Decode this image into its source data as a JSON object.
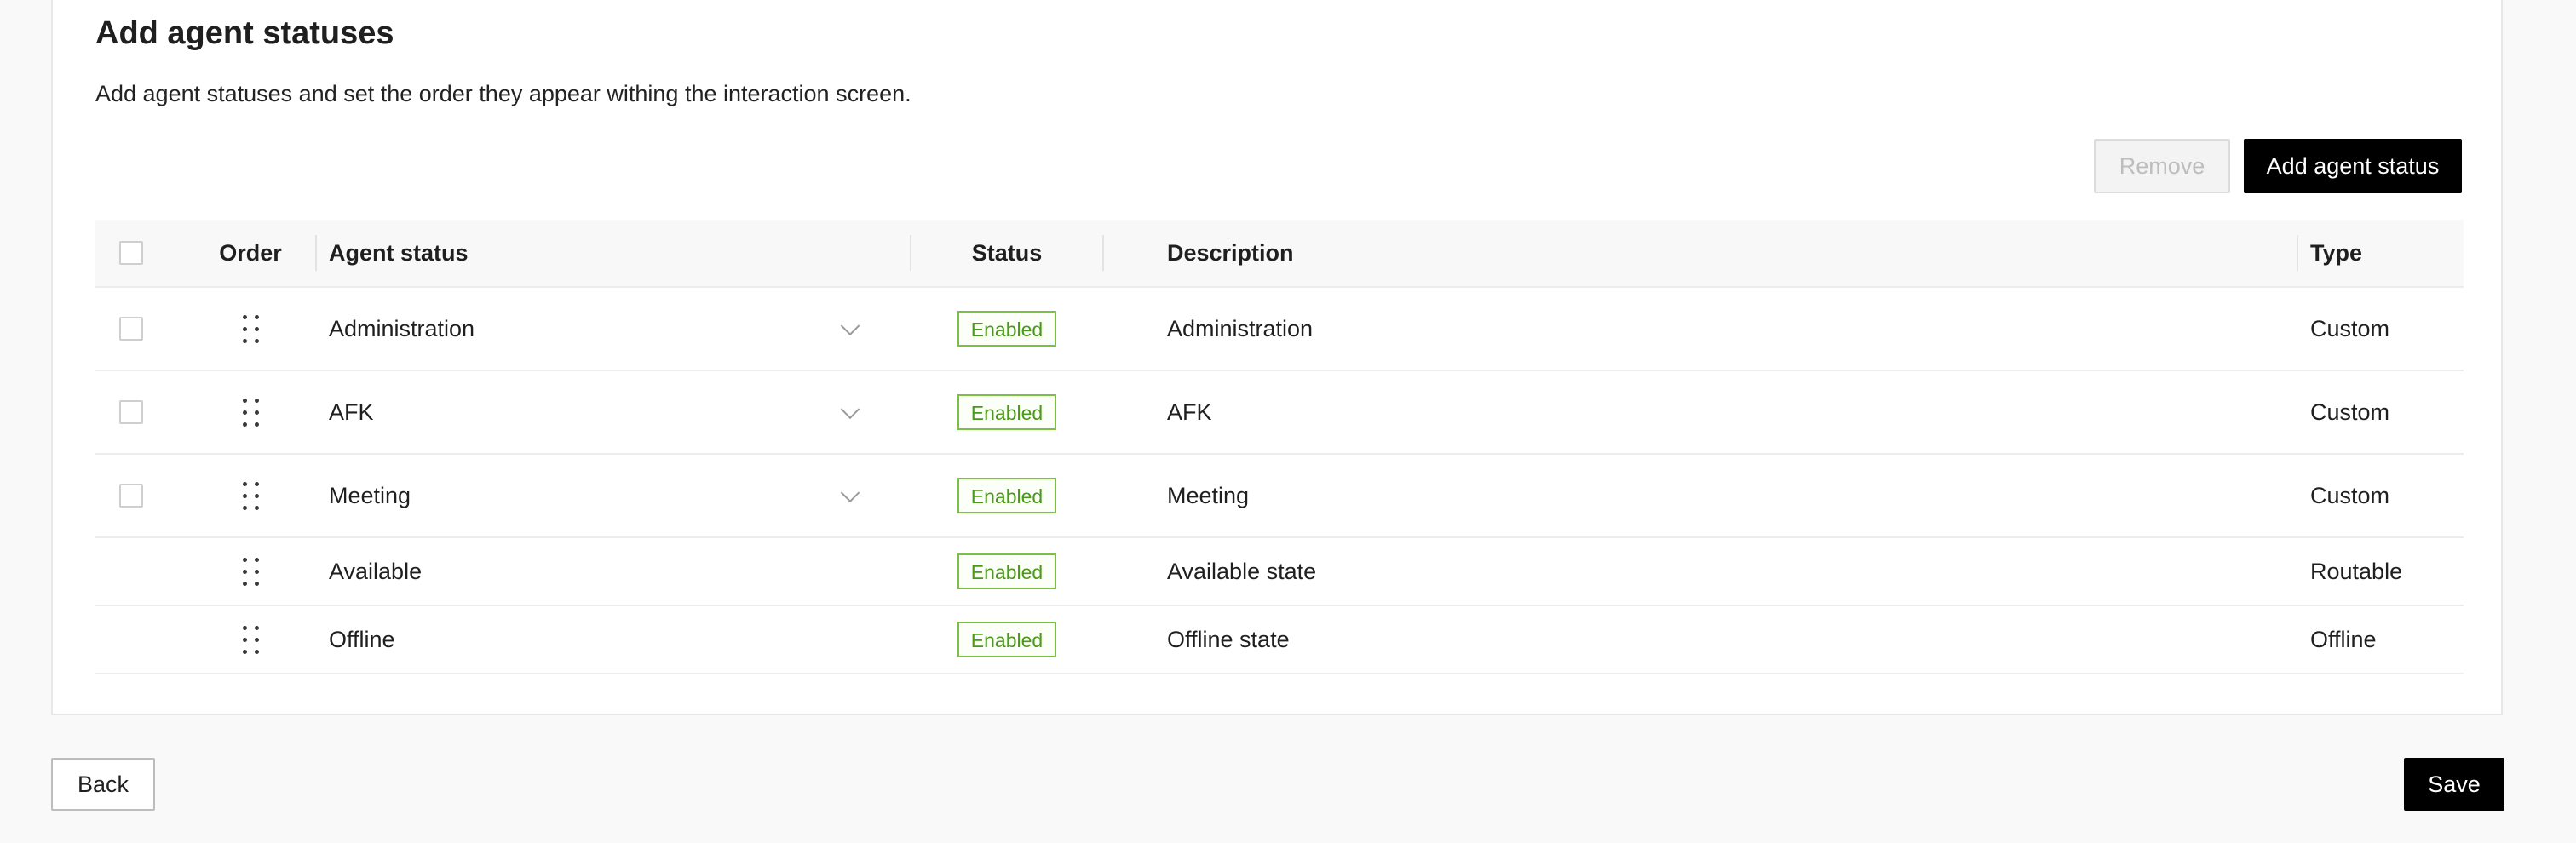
{
  "section": {
    "title": "Add agent statuses",
    "description": "Add agent statuses and set the order they appear withing the interaction screen."
  },
  "toolbar": {
    "remove_label": "Remove",
    "add_label": "Add agent status"
  },
  "table": {
    "columns": {
      "order": "Order",
      "agent_status": "Agent status",
      "status": "Status",
      "description": "Description",
      "type": "Type"
    },
    "rows": [
      {
        "agent_status": "Administration",
        "status": "Enabled",
        "description": "Administration",
        "type": "Custom",
        "selectable": true,
        "dropdown": true
      },
      {
        "agent_status": "AFK",
        "status": "Enabled",
        "description": "AFK",
        "type": "Custom",
        "selectable": true,
        "dropdown": true
      },
      {
        "agent_status": "Meeting",
        "status": "Enabled",
        "description": "Meeting",
        "type": "Custom",
        "selectable": true,
        "dropdown": true
      },
      {
        "agent_status": "Available",
        "status": "Enabled",
        "description": "Available state",
        "type": "Routable",
        "selectable": false,
        "dropdown": false
      },
      {
        "agent_status": "Offline",
        "status": "Enabled",
        "description": "Offline state",
        "type": "Offline",
        "selectable": false,
        "dropdown": false
      }
    ]
  },
  "footer": {
    "back_label": "Back",
    "save_label": "Save"
  },
  "colors": {
    "primary_button": "#000000",
    "enabled_badge": "#7ac143",
    "background": "#f9f9f9"
  },
  "icons": {
    "drag": "drag-handle-icon",
    "dropdown": "chevron-down-icon",
    "checkbox": "checkbox-icon"
  }
}
